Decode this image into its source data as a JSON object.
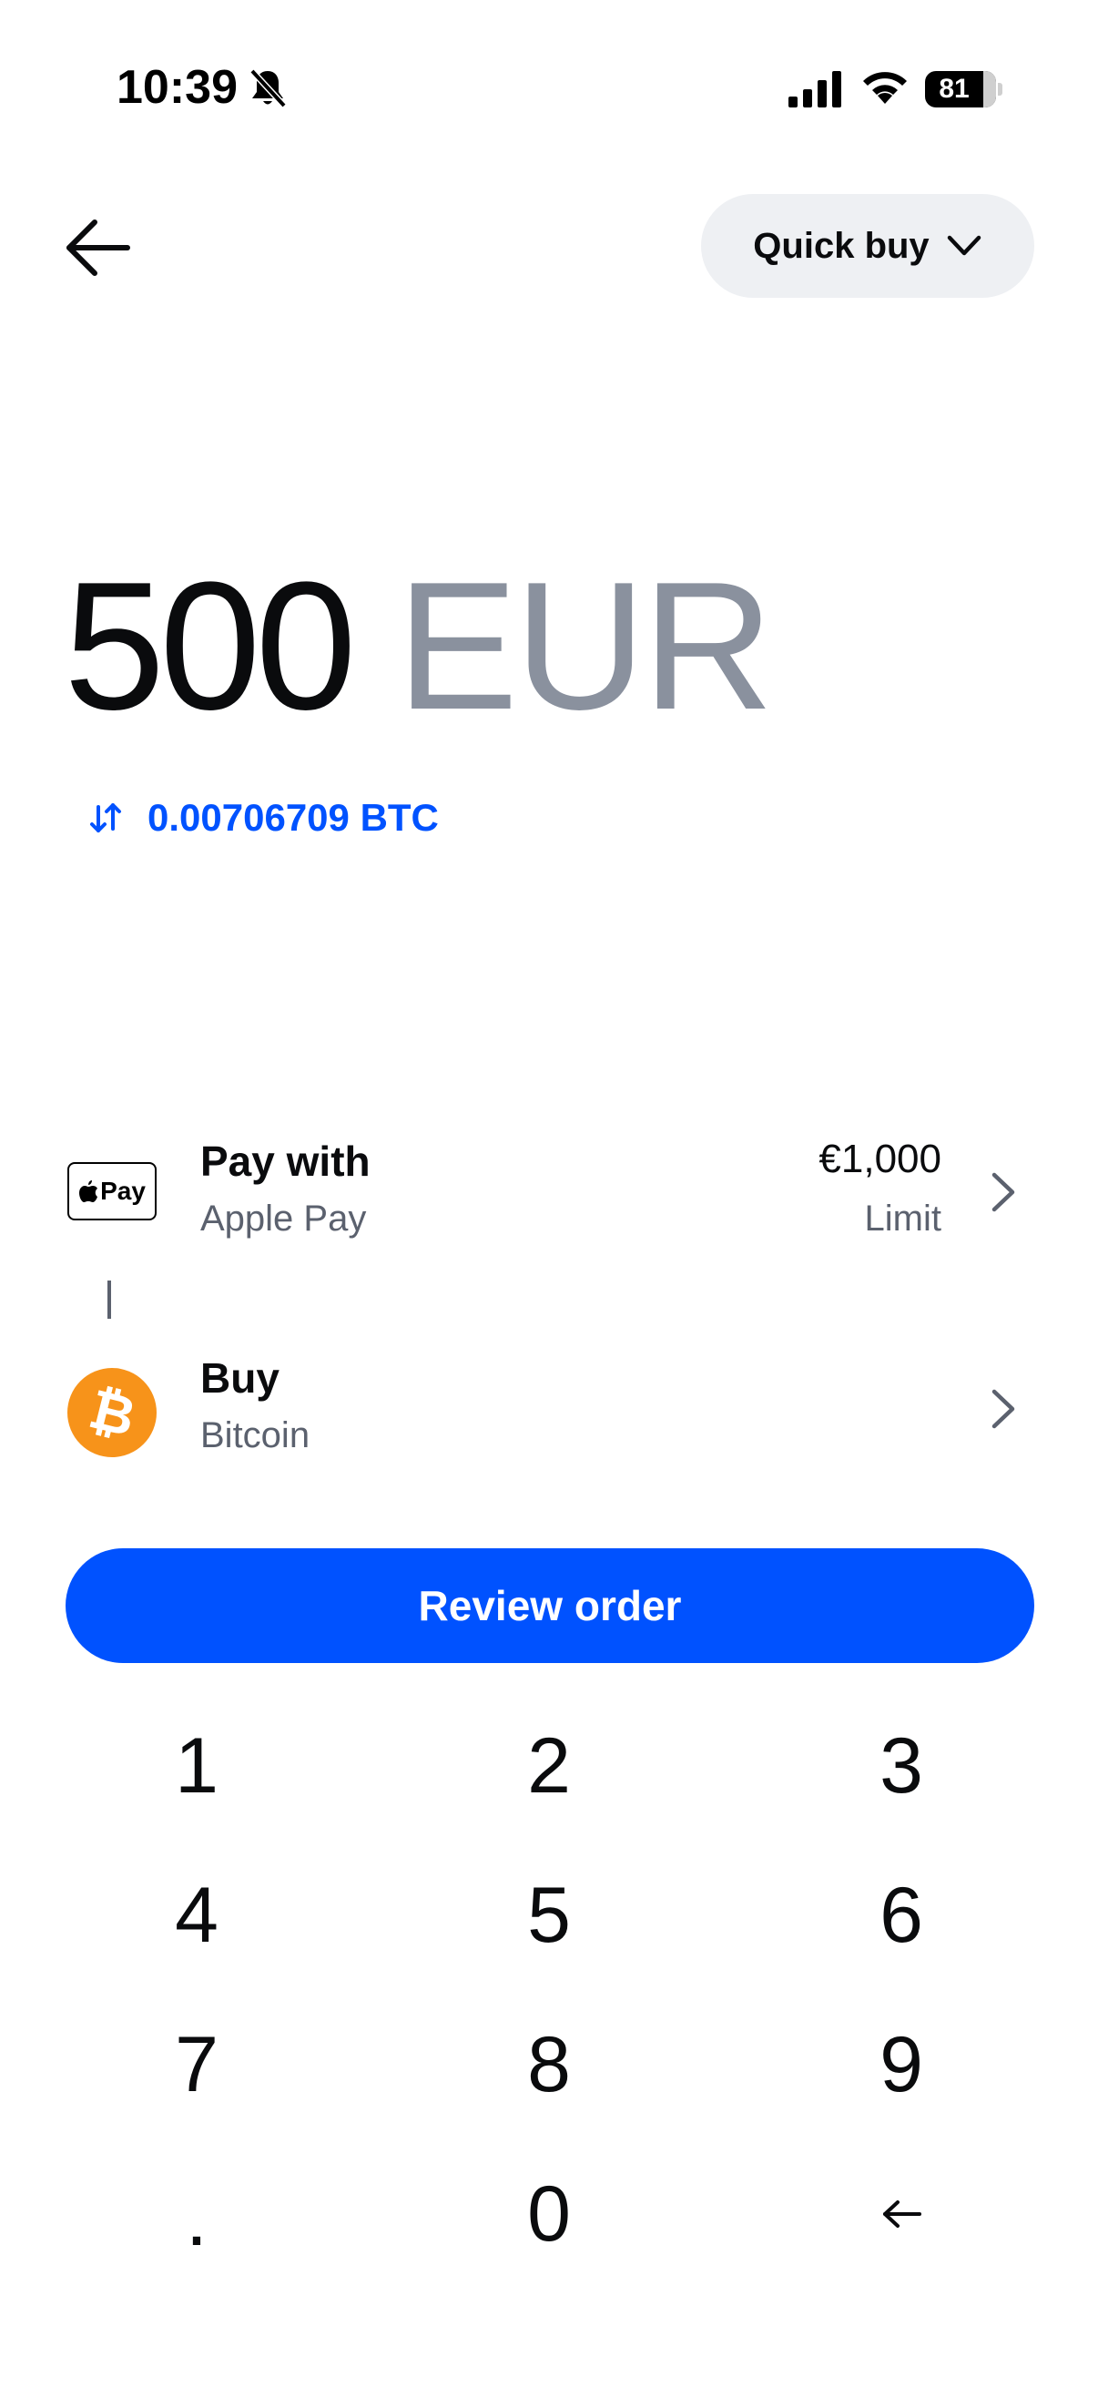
{
  "status_bar": {
    "time": "10:39",
    "battery_level": "81",
    "icons": [
      "bell-off-icon",
      "signal-icon",
      "wifi-icon",
      "battery-icon"
    ]
  },
  "header": {
    "back_icon": "arrow-left-icon",
    "mode_selector_label": "Quick buy",
    "mode_selector_icon": "chevron-down-icon"
  },
  "amount": {
    "value": "500",
    "currency": "EUR",
    "conversion": "0.00706709 BTC",
    "conversion_icon": "swap-icon"
  },
  "payment": {
    "title": "Pay with",
    "method": "Apple Pay",
    "badge_text": "Pay",
    "limit_value": "€1,000",
    "limit_label": "Limit"
  },
  "asset": {
    "title": "Buy",
    "name": "Bitcoin",
    "logo_symbol": "₿"
  },
  "review_button": {
    "label": "Review order"
  },
  "keypad": {
    "keys": [
      "1",
      "2",
      "3",
      "4",
      "5",
      "6",
      "7",
      "8",
      "9",
      ".",
      "0"
    ],
    "backspace_icon": "backspace-arrow-icon"
  },
  "colors": {
    "accent": "#0052ff",
    "muted_text": "#8a919e",
    "secondary_text": "#5b616e",
    "pill_background": "#eef0f3",
    "bitcoin_orange": "#f7931a"
  }
}
